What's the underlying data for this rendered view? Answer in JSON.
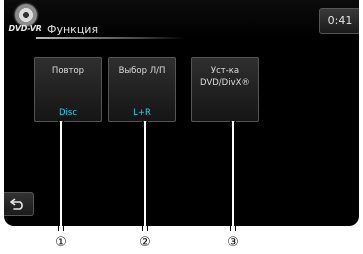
{
  "header": {
    "logo_text": "DVD-VR",
    "title": "Функция",
    "clock": "0:41"
  },
  "tiles": [
    {
      "label": "Повтор",
      "value": "Disc"
    },
    {
      "label": "Выбор Л/П",
      "value": "L+R"
    },
    {
      "label": "Уст-ка DVD/DivX®",
      "value": ""
    }
  ],
  "callouts": [
    "①",
    "②",
    "③"
  ],
  "back_icon": "back-arrow-icon",
  "colors": {
    "background": "#000000",
    "value_accent": "#2ad4e6",
    "tile_border": "#555555"
  }
}
